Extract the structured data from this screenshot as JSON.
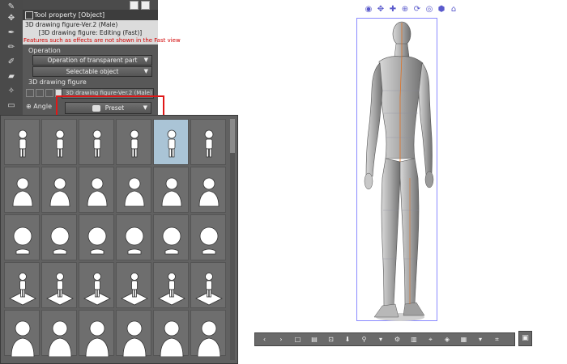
{
  "panel": {
    "tab_title": "Tool property [Object]",
    "object_name": "3D drawing figure-Ver.2 (Male)",
    "mode_text": "[3D drawing figure: Editing (Fast)]",
    "warning": "Features such as effects are not shown in the Fast view",
    "operation_label": "Operation",
    "operation_value": "Operation of transparent part",
    "selectable_value": "Selectable object",
    "figure_section_label": "3D drawing figure",
    "figure_item": "3D drawing figure-Ver.2 (Male)",
    "angle_label": "Angle",
    "preset_label": "Preset",
    "preset_highlight_color": "#e01818"
  },
  "preset_grid": {
    "columns": 6,
    "rows": 5,
    "selected_index": 4,
    "row_types": [
      "full-body",
      "bust",
      "head",
      "floor-figure",
      "bust-large"
    ]
  },
  "launcher_icons": [
    "move-camera-icon",
    "pan-icon",
    "zoom-icon",
    "move-plane-icon",
    "rotate-icon",
    "rotate-z-icon",
    "move-object-icon",
    "ground-icon"
  ],
  "bottom_toolbar_icons": [
    "prev-icon",
    "next-icon",
    "select-icon",
    "camera-icon",
    "fit-icon",
    "pose-icon",
    "figure-icon",
    "arrow-down",
    "settings-icon",
    "layout-icon",
    "lock-icon",
    "ground-icon",
    "view-icon",
    "arrow-down",
    "extra-icon"
  ],
  "colors": {
    "viewport_border": "#8a8aff",
    "center_line": "#e07020"
  }
}
